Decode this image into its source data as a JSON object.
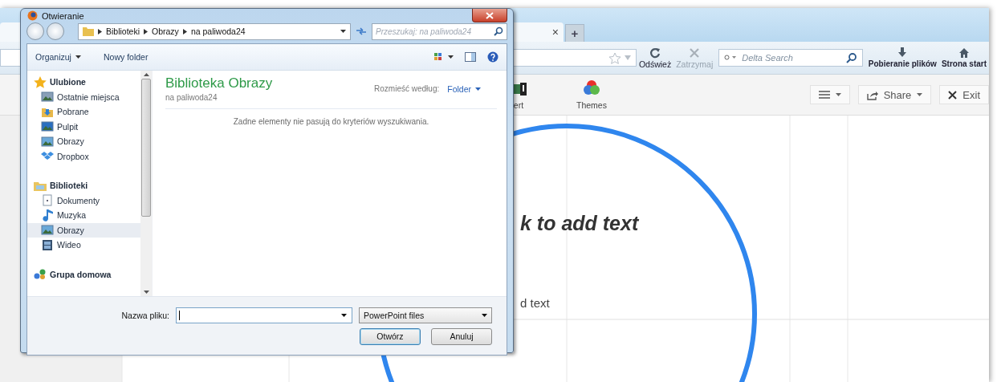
{
  "browser": {
    "tab": {
      "close": "×"
    },
    "new_tab": "+",
    "nav_buttons": [
      {
        "kind": "reload",
        "label": "Odśwież",
        "disabled": false
      },
      {
        "kind": "stop",
        "label": "Zatrzymaj",
        "disabled": true
      }
    ],
    "search": {
      "placeholder": "Delta Search"
    },
    "shortcuts": [
      {
        "kind": "download",
        "label": "Pobieranie plików"
      },
      {
        "kind": "home",
        "label": "Strona start"
      }
    ],
    "toolbar": [
      {
        "kind": "image",
        "label": "ert"
      },
      {
        "kind": "themes",
        "label": "Themes"
      }
    ],
    "toolbar_buttons": [
      {
        "kind": "menu"
      },
      {
        "kind": "share",
        "label": "Share"
      },
      {
        "kind": "exit",
        "label": "Exit"
      }
    ],
    "canvas": {
      "title": "k to add text",
      "subtitle": "d text"
    }
  },
  "dialog": {
    "title": "Otwieranie",
    "breadcrumbs": [
      "Biblioteki",
      "Obrazy",
      "na paliwoda24"
    ],
    "search": {
      "placeholder": "Przeszukaj: na paliwoda24"
    },
    "commands": [
      {
        "label": "Organizuj",
        "dropdown": true
      },
      {
        "label": "Nowy folder",
        "dropdown": false
      }
    ],
    "sidebar": [
      {
        "label": "Ulubione",
        "kind": "star",
        "selected": false,
        "children": [
          {
            "label": "Ostatnie miejsca",
            "kind": "recent",
            "selected": false
          },
          {
            "label": "Pobrane",
            "kind": "download",
            "selected": false
          },
          {
            "label": "Pulpit",
            "kind": "desktop",
            "selected": false
          },
          {
            "label": "Obrazy",
            "kind": "pictures",
            "selected": false
          },
          {
            "label": "Dropbox",
            "kind": "dropbox",
            "selected": false
          }
        ]
      },
      {
        "label": "Biblioteki",
        "kind": "library",
        "selected": false,
        "children": [
          {
            "label": "Dokumenty",
            "kind": "document",
            "selected": false
          },
          {
            "label": "Muzyka",
            "kind": "music",
            "selected": false
          },
          {
            "label": "Obrazy",
            "kind": "pictures",
            "selected": true
          },
          {
            "label": "Wideo",
            "kind": "video",
            "selected": false
          }
        ]
      },
      {
        "label": "Grupa domowa",
        "kind": "homegroup",
        "selected": false
      }
    ],
    "library": {
      "title": "Biblioteka Obrazy",
      "subtitle": "na paliwoda24",
      "arrange_label": "Rozmieść według:",
      "arrange_value": "Folder"
    },
    "empty_message": "Zadne elementy nie pasują do kryteriów wyszukiwania.",
    "filename": {
      "label": "Nazwa pliku:"
    },
    "filetype": "PowerPoint files",
    "buttons": [
      {
        "label": "Otwórz",
        "default": true
      },
      {
        "label": "Anuluj",
        "default": false
      }
    ]
  }
}
